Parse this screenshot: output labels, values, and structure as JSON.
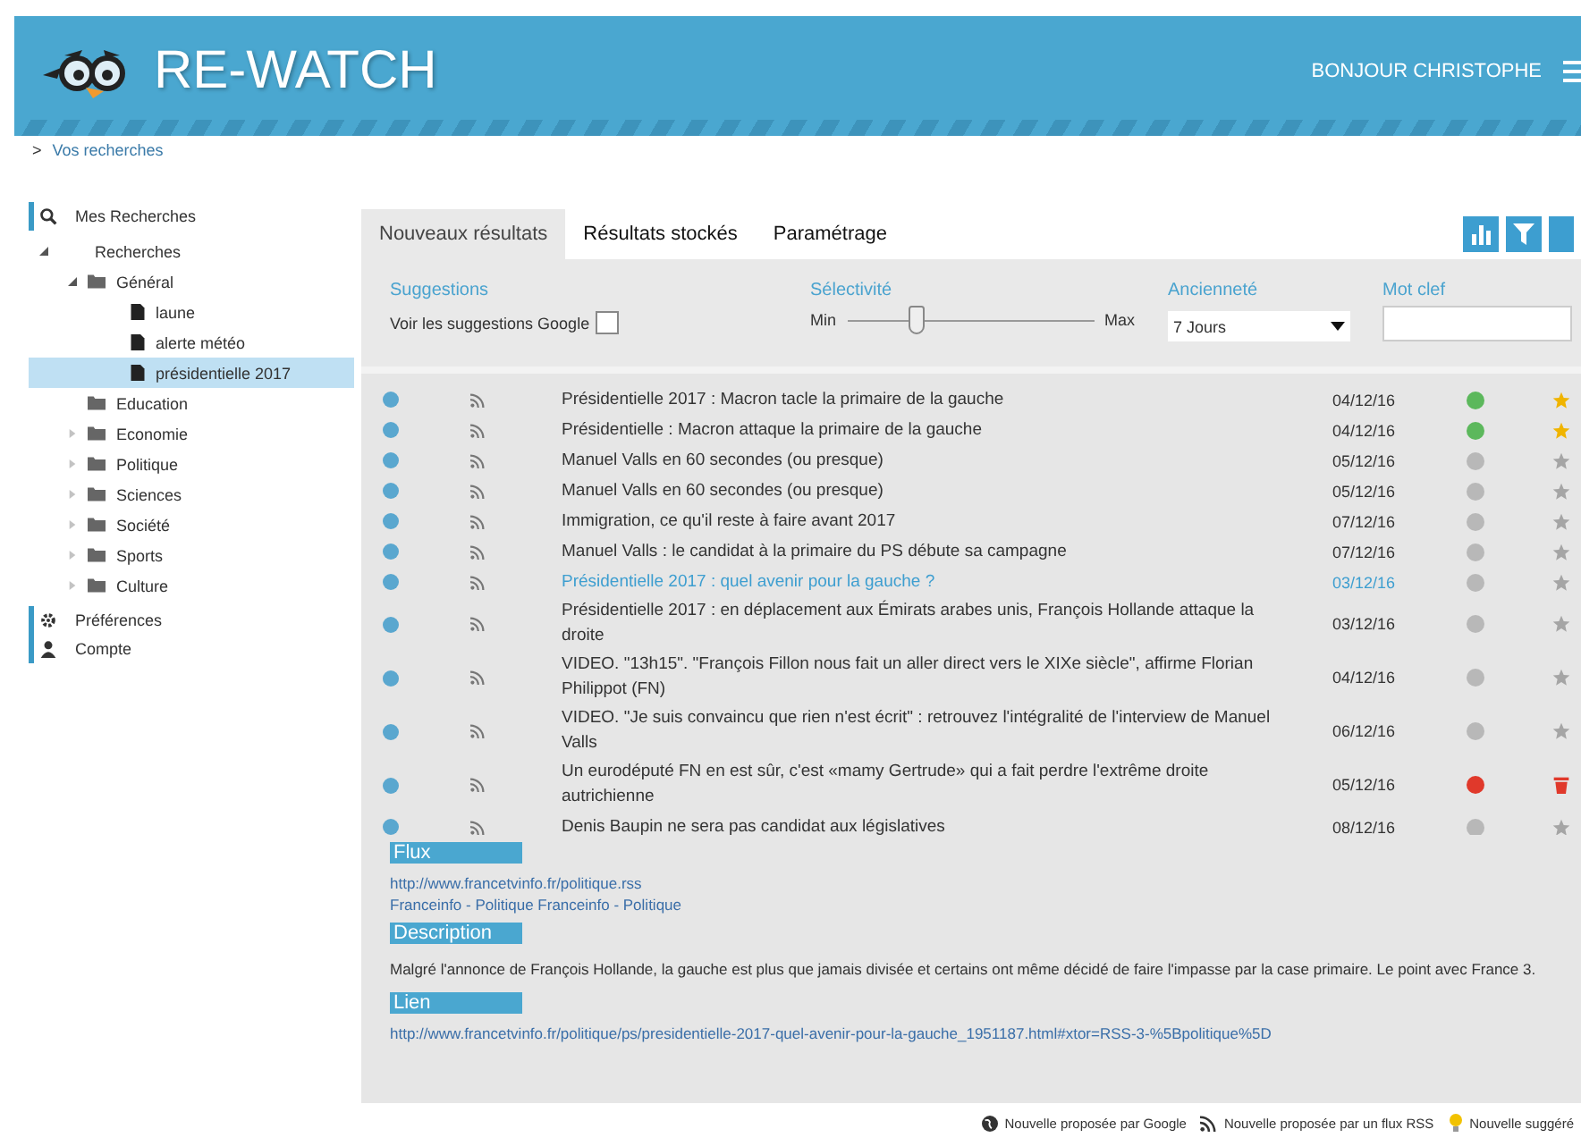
{
  "header": {
    "title": "RE-WATCH",
    "greeting": "BONJOUR CHRISTOPHE"
  },
  "breadcrumb": {
    "arrow": ">",
    "label": "Vos recherches"
  },
  "sidebar": {
    "sections": [
      {
        "kind": "search",
        "label": "Mes Recherches",
        "children": [
          {
            "label": "Recherches",
            "expanded": true,
            "children": [
              {
                "label": "Général",
                "expanded": true,
                "kind": "folder",
                "children": [
                  {
                    "label": "laune",
                    "kind": "file",
                    "selected": false
                  },
                  {
                    "label": "alerte météo",
                    "kind": "file",
                    "selected": false
                  },
                  {
                    "label": "présidentielle 2017",
                    "kind": "file",
                    "selected": true
                  }
                ]
              },
              {
                "label": "Education",
                "kind": "empty-folder"
              },
              {
                "label": "Economie",
                "expanded": false,
                "kind": "folder"
              },
              {
                "label": "Politique",
                "expanded": false,
                "kind": "folder"
              },
              {
                "label": "Sciences",
                "expanded": false,
                "kind": "folder"
              },
              {
                "label": "Société",
                "expanded": false,
                "kind": "folder"
              },
              {
                "label": "Sports",
                "expanded": false,
                "kind": "folder"
              },
              {
                "label": "Culture",
                "expanded": false,
                "kind": "folder"
              }
            ]
          }
        ]
      },
      {
        "kind": "gear",
        "label": "Préférences"
      },
      {
        "kind": "user",
        "label": "Compte"
      }
    ]
  },
  "tabs": [
    {
      "label": "Nouveaux résultats",
      "selected": true
    },
    {
      "label": "Résultats stockés",
      "selected": false
    },
    {
      "label": "Paramétrage",
      "selected": false
    }
  ],
  "filters": {
    "suggestions": {
      "title": "Suggestions",
      "label": "Voir les suggestions Google",
      "checked": false
    },
    "selectivity": {
      "title": "Sélectivité",
      "min": "Min",
      "max": "Max",
      "level": 0.28
    },
    "age": {
      "title": "Ancienneté",
      "value": "7 Jours"
    },
    "keyword": {
      "title": "Mot clef"
    }
  },
  "rows": [
    {
      "title": "Présidentielle 2017 : Macron tacle la primaire de la gauche",
      "date": "04/12/16",
      "color": "#5cb85c",
      "kind": "star",
      "starred": true,
      "selected": false
    },
    {
      "title": "Présidentielle : Macron attaque la primaire de la gauche",
      "date": "04/12/16",
      "color": "#5cb85c",
      "kind": "star",
      "starred": true,
      "selected": false
    },
    {
      "title": "Manuel Valls en 60 secondes (ou presque)",
      "date": "05/12/16",
      "color": "#b8b8b8",
      "kind": "star",
      "starred": false,
      "selected": false
    },
    {
      "title": "Manuel Valls en 60 secondes (ou presque)",
      "date": "05/12/16",
      "color": "#b8b8b8",
      "kind": "star",
      "starred": false,
      "selected": false
    },
    {
      "title": "Immigration, ce qu'il reste à faire avant 2017",
      "date": "07/12/16",
      "color": "#b8b8b8",
      "kind": "star",
      "starred": false,
      "selected": false
    },
    {
      "title": "Manuel Valls : le candidat à la primaire du PS débute sa campagne",
      "date": "07/12/16",
      "color": "#b8b8b8",
      "kind": "star",
      "starred": false,
      "selected": false
    },
    {
      "title": "Présidentielle 2017 : quel avenir pour la gauche ?",
      "date": "03/12/16",
      "color": "#b8b8b8",
      "kind": "star",
      "starred": false,
      "selected": true
    },
    {
      "title": "Présidentielle 2017 : en déplacement aux Émirats arabes unis, François Hollande attaque la droite",
      "date": "03/12/16",
      "color": "#b8b8b8",
      "kind": "star",
      "starred": false,
      "selected": false
    },
    {
      "title": "VIDEO. \"13h15\". \"François Fillon nous fait un aller direct vers le XIXe siècle\", affirme Florian Philippot (FN)",
      "date": "04/12/16",
      "color": "#b8b8b8",
      "kind": "star",
      "starred": false,
      "selected": false
    },
    {
      "title": "VIDEO. \"Je suis convaincu que rien n'est écrit\" : retrouvez l'intégralité de l'interview de Manuel Valls",
      "date": "06/12/16",
      "color": "#b8b8b8",
      "kind": "star",
      "starred": false,
      "selected": false
    },
    {
      "title": "Un eurodéputé FN en est sûr, c'est «mamy Gertrude» qui a fait perdre l'extrême droite autrichienne",
      "date": "05/12/16",
      "color": "#e0392b",
      "kind": "trash",
      "selected": false
    },
    {
      "title": "Denis Baupin ne sera pas candidat aux législatives",
      "date": "08/12/16",
      "color": "#b8b8b8",
      "kind": "star",
      "starred": false,
      "selected": false
    }
  ],
  "details": [
    {
      "heading": "Flux",
      "lines": [
        "http://www.francetvinfo.fr/politique.rss",
        "Franceinfo - Politique Franceinfo - Politique"
      ],
      "kind": "link"
    },
    {
      "heading": "Description",
      "lines": [
        "Malgré l'annonce de François Hollande, la gauche est plus que jamais divisée et certains ont même décidé de faire l'impasse par la case primaire. Le point avec France 3."
      ],
      "kind": "text"
    },
    {
      "heading": "Lien",
      "lines": [
        "http://www.francetvinfo.fr/politique/ps/presidentielle-2017-quel-avenir-pour-la-gauche_1951187.html#xtor=RSS-3-%5Bpolitique%5D"
      ],
      "kind": "link"
    }
  ],
  "legend": [
    {
      "kind": "globe",
      "label": "Nouvelle proposée par Google"
    },
    {
      "kind": "rss",
      "label": "Nouvelle proposée par un flux RSS"
    },
    {
      "kind": "bulb",
      "label": "Nouvelle suggéré"
    }
  ]
}
